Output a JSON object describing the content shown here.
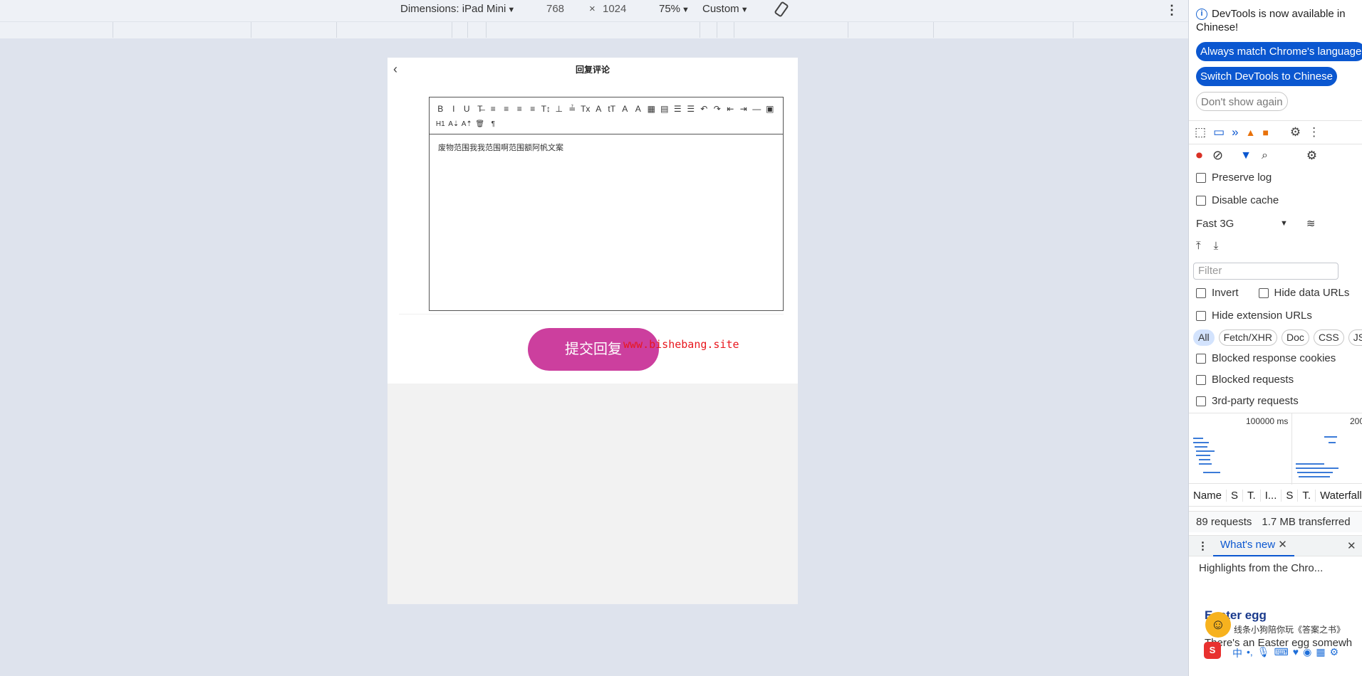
{
  "device_toolbar": {
    "dimensions_label": "Dimensions: iPad Mini",
    "width": "768",
    "times": "×",
    "height": "1024",
    "zoom": "75%",
    "throttle": "Custom",
    "rotate_icon": "rotate-icon",
    "more_icon": "kebab-icon"
  },
  "page": {
    "title": "回复评论",
    "back_icon": "chevron-left-icon",
    "editor_toolbar_row1": [
      "B",
      "I",
      "U",
      "T̶",
      "≡",
      "≡",
      "≡",
      "≡",
      "T↕",
      "⊥",
      "≟",
      "Tx",
      "A",
      "tT",
      "A",
      "A",
      "▦",
      "▤",
      "☰",
      "☰",
      "↶",
      "↷",
      "⇤",
      "⇥",
      "—",
      "▣"
    ],
    "editor_toolbar_row2": [
      "H1",
      "A⇣",
      "A⇡",
      "🗑",
      "¶"
    ],
    "editor_content": "废物范围我我范围啊范围额阿帆文案",
    "submit_label": "提交回复",
    "submit_color": "#cc3f9e"
  },
  "watermark": "www.bishebang.site",
  "devtools": {
    "notice_text": "DevTools is now available in Chinese!",
    "btn_match": "Always match Chrome's language",
    "btn_switch": "Switch DevTools to Chinese",
    "btn_dont_show": "Don't show again",
    "preserve_log": "Preserve log",
    "disable_cache": "Disable cache",
    "throttle_value": "Fast 3G",
    "filter_placeholder": "Filter",
    "invert": "Invert",
    "hide_data_urls": "Hide data URLs",
    "hide_extension_urls": "Hide extension URLs",
    "type_filters": [
      "All",
      "Fetch/XHR",
      "Doc",
      "CSS",
      "JS"
    ],
    "blocked_cookies": "Blocked response cookies",
    "blocked_requests": "Blocked requests",
    "third_party": "3rd-party requests",
    "overview_tick1": "100000 ms",
    "overview_tick2": "200",
    "columns": [
      "Name",
      "S",
      "T.",
      "I...",
      "S",
      "T.",
      "Waterfall"
    ],
    "requests_count": "89 requests",
    "transferred": "1.7 MB transferred",
    "drawer_tab": "What's new",
    "highlights": "Highlights from the Chro...",
    "easter_title": "Easter egg",
    "easter_sub": "There's an Easter egg somewh",
    "ime_popup": "线条小狗陪你玩《答案之书》",
    "ime_lang": "中"
  }
}
